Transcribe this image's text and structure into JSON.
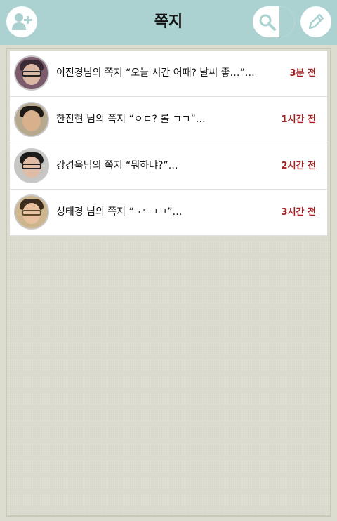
{
  "header": {
    "title": "쪽지",
    "add_friend_icon": "add-user-icon",
    "search_icon": "search-icon",
    "compose_icon": "pencil-icon"
  },
  "colors": {
    "header_bg": "#abd2d1",
    "time_text": "#a02222",
    "panel_bg": "#dcdcd0"
  },
  "messages": [
    {
      "text": "이진경님의 쪽지 “오늘 시간 어때? 날씨 좋…”…",
      "time": "3분 전"
    },
    {
      "text": "한진현 님의 쪽지 “ㅇㄷ? 롤 ㄱㄱ”…",
      "time": "1시간 전"
    },
    {
      "text": "강경욱님의 쪽지 “뭐하냐?”…",
      "time": "2시간 전"
    },
    {
      "text": "성태경 님의 쪽지 “ ㄹ ㄱㄱ”…",
      "time": "3시간 전"
    }
  ]
}
